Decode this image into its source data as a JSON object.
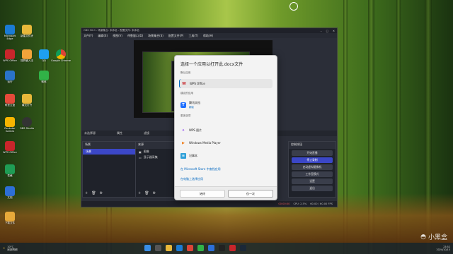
{
  "desktop": {
    "icons_left": [
      {
        "label": "Microsoft\nEdge",
        "color": "#1b7bd4"
      },
      {
        "label": "WPS Office",
        "color": "#c8262b"
      },
      {
        "label": "运行",
        "color": "#2a73c8"
      },
      {
        "label": "阿里云盘",
        "color": "#e64a3a"
      },
      {
        "label": "加速器",
        "color": "#2b71d8"
      },
      {
        "label": "PPT演示",
        "color": "#d84d2a"
      },
      {
        "label": "Rockstar\nGames",
        "color": "#f7b500"
      },
      {
        "label": "WPS Office",
        "color": "#c8262b"
      },
      {
        "label": "表格",
        "color": "#1f9d55"
      },
      {
        "label": "文档",
        "color": "#2d6fd8"
      },
      {
        "label": "下载文件",
        "color": "#e8a93a"
      }
    ],
    "icons_second": [
      {
        "label": "新建文件夹",
        "color": "#e8b83a"
      },
      {
        "label": "搜狗输入法",
        "color": "#f3a43a"
      },
      {
        "label": "QQ",
        "color": "#1ea0f0"
      },
      {
        "label": "微信",
        "color": "#31b247"
      },
      {
        "label": "最近打开",
        "color": "#e8b83a"
      },
      {
        "label": "OBS Studio",
        "color": "#333333"
      }
    ],
    "chrome_icon_label": "Google Chrome",
    "steam_label": "Steam"
  },
  "obs": {
    "title": "OBS 30.0 - 场景集合: 未命名 - 配置文件: 未命名",
    "menu": [
      "文件(F)",
      "编辑(E)",
      "视图(V)",
      "停靠窗口(D)",
      "场景集合(S)",
      "配置文件(P)",
      "工具(T)",
      "帮助(H)"
    ],
    "status_row": [
      "未选择源",
      "属性",
      "滤镜"
    ],
    "scenes_title": "场景",
    "scene_item": "场景",
    "sources_title": "来源",
    "sources": [
      "图像",
      "显示器采集"
    ],
    "controls_title": "控制按钮",
    "controls": [
      "开始直播",
      "停止录制",
      "启动虚拟摄像机",
      "工作室模式",
      "设置",
      "退出"
    ],
    "statusbar": [
      "00:00:00",
      "CPU: 2.5%",
      "60.00 / 60.00 FPS"
    ]
  },
  "dialog": {
    "title": "选择一个应用以打开此.docx文件",
    "section_current": "默认应用",
    "current_app": "WPS Office",
    "section_suggested": "建议的应用",
    "suggested_app": "腾讯文档",
    "suggested_sub": "新版",
    "section_more": "更多选项",
    "more_apps": [
      "WPS 图片",
      "Windows Media Player",
      "记事本"
    ],
    "link_store": "在 Microsoft Store 中查找应用",
    "link_pc": "在电脑上选择应用",
    "btn_always": "始终",
    "btn_once": "仅一次"
  },
  "taskbar": {
    "weather_temp": "10°C",
    "weather_text": "局部晴朗",
    "time": "23:52",
    "date": "2024/10/15"
  },
  "watermark": "小黑盒",
  "colors": {
    "accent": "#3b47c7",
    "dialog_link": "#0067c0"
  }
}
